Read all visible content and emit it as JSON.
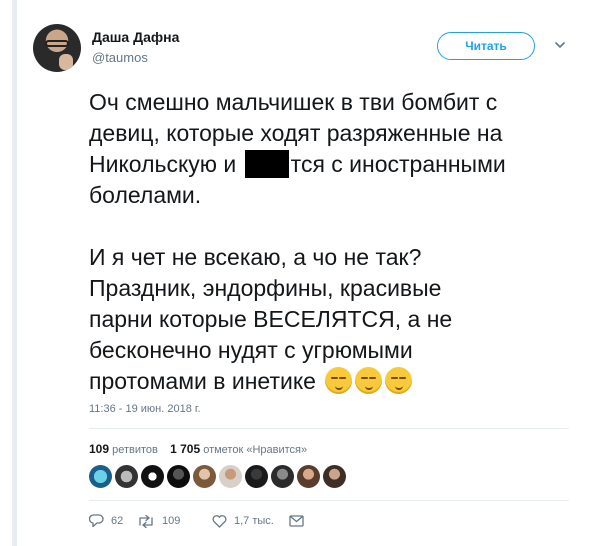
{
  "author": {
    "display_name": "Даша Дафна",
    "handle": "@taumos"
  },
  "header": {
    "follow_label": "Читать",
    "more_icon": "chevron-down-icon"
  },
  "tweet": {
    "line1": "Оч смешно мальчишек в тви бомбит с",
    "line2": "девиц, которые ходят разряженные на",
    "line3_before": "Никольскую и ",
    "line3_after": "тся с иностранными",
    "line4": "болелами.",
    "line5": "И я чет не всекаю, а чо не так?",
    "line6": "Праздник, эндорфины, красивые",
    "line7": "парни которые ВЕСЕЛЯТСЯ, а не",
    "line8": "бесконечно нудят с угрюмыми",
    "line9": "протомами в инетике",
    "emoji": [
      "smirking-face-emoji",
      "smirking-face-emoji",
      "smirking-face-emoji"
    ],
    "timestamp": "11:36 - 19 июн. 2018 г."
  },
  "stats": {
    "retweets_count": "109",
    "retweets_label": "ретвитов",
    "likes_count": "1 705",
    "likes_label": "отметок «Нравится»",
    "liker_avatars": 10
  },
  "actions": {
    "replies": "62",
    "retweets": "109",
    "likes": "1,7 тыс."
  },
  "colors": {
    "accent": "#1da1f2",
    "text": "#14171a",
    "muted": "#657786",
    "divider": "#e6ecf0"
  }
}
